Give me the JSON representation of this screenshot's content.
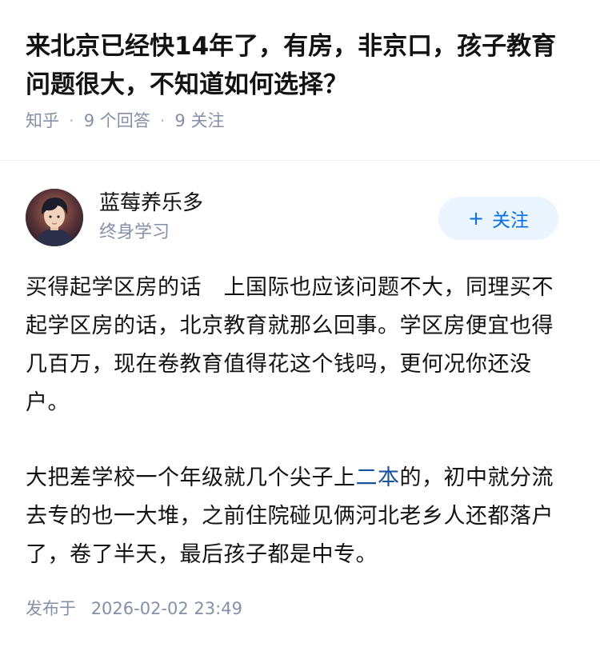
{
  "question": {
    "title": "来北京已经快14年了，有房，非京口，孩子教育问题很大，不知道如何选择？",
    "source": "知乎",
    "answers_count": "9 个回答",
    "followers_count": "9 关注"
  },
  "author": {
    "name": "蓝莓养乐多",
    "bio": "终身学习",
    "follow_label": "关注",
    "follow_icon": "plus-icon"
  },
  "answer": {
    "paragraph1": "买得起学区房的话　上国际也应该问题不大，同理买不起学区房的话，北京教育就那么回事。学区房便宜也得几百万，现在卷教育值得花这个钱吗，更何况你还没户。",
    "paragraph2_before": "大把差学校一个年级就几个尖子上",
    "paragraph2_link": "二本",
    "paragraph2_after": "的，初中就分流去专的也一大堆，之前住院碰见俩河北老乡人还都落户了，卷了半天，最后孩子都是中专。"
  },
  "footer": {
    "publish_label": "发布于",
    "publish_time": "2026-02-02 23:49"
  },
  "colors": {
    "text": "#121212",
    "meta": "#8590a6",
    "follow_bg": "#ebf5ff",
    "follow_text": "#056de8",
    "link": "#175199"
  }
}
